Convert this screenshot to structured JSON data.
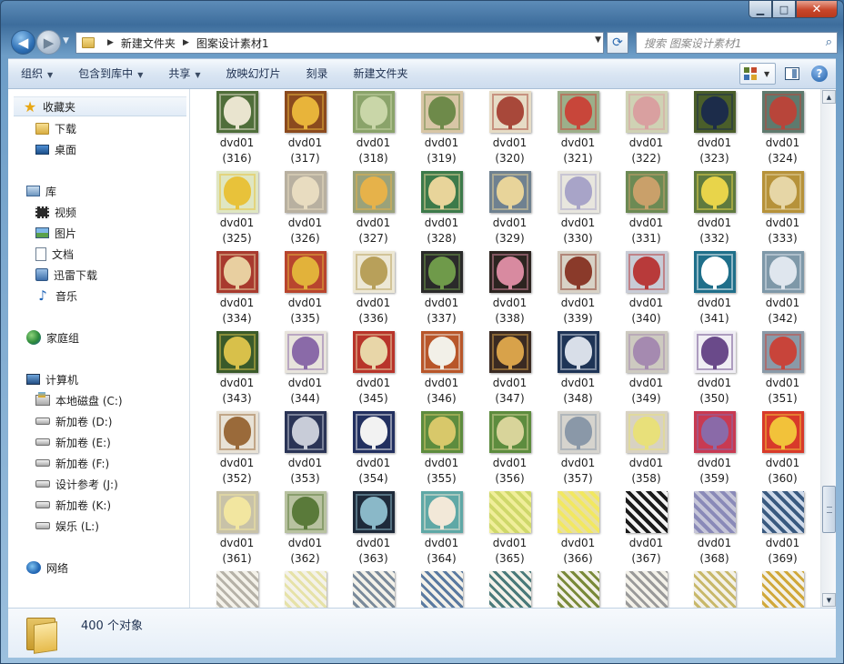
{
  "window": {
    "caption": {
      "minimize": "▁",
      "maximize": "□",
      "close": "✕"
    }
  },
  "address": {
    "crumbs": [
      "新建文件夹",
      "图案设计素材1"
    ],
    "search_placeholder": "搜索 图案设计素材1"
  },
  "toolbar": {
    "items": [
      {
        "label": "组织",
        "dropdown": true
      },
      {
        "label": "包含到库中",
        "dropdown": true
      },
      {
        "label": "共享",
        "dropdown": true
      },
      {
        "label": "放映幻灯片",
        "dropdown": false
      },
      {
        "label": "刻录",
        "dropdown": false
      },
      {
        "label": "新建文件夹",
        "dropdown": false
      }
    ],
    "help_label": "?"
  },
  "sidebar": {
    "favorites": {
      "label": "收藏夹",
      "items": [
        "下载",
        "桌面"
      ]
    },
    "libraries": {
      "label": "库",
      "items": [
        "视频",
        "图片",
        "文档",
        "迅雷下载",
        "音乐"
      ]
    },
    "homegroup": {
      "label": "家庭组"
    },
    "computer": {
      "label": "计算机",
      "items": [
        "本地磁盘 (C:)",
        "新加卷 (D:)",
        "新加卷 (E:)",
        "新加卷 (F:)",
        "设计参考 (J:)",
        "新加卷 (K:)",
        "娱乐 (L:)"
      ]
    },
    "network": {
      "label": "网络"
    }
  },
  "files": {
    "name_prefix": "dvd01",
    "items": [
      "(316)",
      "(317)",
      "(318)",
      "(319)",
      "(320)",
      "(321)",
      "(322)",
      "(323)",
      "(324)",
      "(325)",
      "(326)",
      "(327)",
      "(328)",
      "(329)",
      "(330)",
      "(331)",
      "(332)",
      "(333)",
      "(334)",
      "(335)",
      "(336)",
      "(337)",
      "(338)",
      "(339)",
      "(340)",
      "(341)",
      "(342)",
      "(343)",
      "(344)",
      "(345)",
      "(346)",
      "(347)",
      "(348)",
      "(349)",
      "(350)",
      "(351)",
      "(352)",
      "(353)",
      "(354)",
      "(355)",
      "(356)",
      "(357)",
      "(358)",
      "(359)",
      "(360)",
      "(361)",
      "(362)",
      "(363)",
      "(364)",
      "(365)",
      "(366)",
      "(367)",
      "(368)",
      "(369)"
    ],
    "partial_row_count": 9
  },
  "details": {
    "count_text": "400 个对象"
  },
  "theme": {
    "tile_colors": [
      [
        "#4f6e3a",
        "#e9e4cf"
      ],
      [
        "#8b4a1e",
        "#e8b43a"
      ],
      [
        "#8aa36a",
        "#c9d6a8"
      ],
      [
        "#d8c6a6",
        "#6e8a4a"
      ],
      [
        "#e6dcc6",
        "#a8483a"
      ],
      [
        "#9caf8a",
        "#c8463a"
      ],
      [
        "#cfd2b4",
        "#d9a0a0"
      ],
      [
        "#4a5e2a",
        "#1c2c4a"
      ],
      [
        "#5e7a6e",
        "#b8453a"
      ],
      [
        "#dfe6c2",
        "#e8c23a"
      ],
      [
        "#b8b0a0",
        "#e8dcc0"
      ],
      [
        "#9aa27a",
        "#e6b24a"
      ],
      [
        "#3c7a4a",
        "#e8d49a"
      ],
      [
        "#6f8190",
        "#e8d49a"
      ],
      [
        "#e8e6de",
        "#a8a4c8"
      ],
      [
        "#6c8a54",
        "#c9a06a"
      ],
      [
        "#5f7a3e",
        "#e8d44a"
      ],
      [
        "#b6923a",
        "#e6d6a6"
      ],
      [
        "#a83a2e",
        "#e8cfa0"
      ],
      [
        "#b8452e",
        "#e2b23a"
      ],
      [
        "#ede8d6",
        "#b8a05a"
      ],
      [
        "#2a2a2a",
        "#6f9a4a"
      ],
      [
        "#2c2420",
        "#d88aa0"
      ],
      [
        "#d8d2c6",
        "#8a3a2a"
      ],
      [
        "#c8ccd6",
        "#b83a3a"
      ],
      [
        "#1f6f8a",
        "#ffffff"
      ],
      [
        "#7e98a8",
        "#dfe6ee"
      ],
      [
        "#3a5a2a",
        "#d8c04a"
      ],
      [
        "#e8e4dc",
        "#8a6aa8"
      ],
      [
        "#b8342a",
        "#e8d6a8"
      ],
      [
        "#b8562a",
        "#f2f0e8"
      ],
      [
        "#3a2a22",
        "#d8a24a"
      ],
      [
        "#1e3456",
        "#d8dee8"
      ],
      [
        "#cdcac0",
        "#a58ab0"
      ],
      [
        "#f0eef4",
        "#6a4a8a"
      ],
      [
        "#8a9aa8",
        "#c8443a"
      ],
      [
        "#e8e2d6",
        "#9a6a3a"
      ],
      [
        "#2a3456",
        "#c8ccd8"
      ],
      [
        "#223060",
        "#f2f2f2"
      ],
      [
        "#5d8c3e",
        "#d8c86a"
      ],
      [
        "#5d8c3e",
        "#d8d49a"
      ],
      [
        "#d6d4ce",
        "#8a98a8"
      ],
      [
        "#d8d2c2",
        "#e8e07a"
      ],
      [
        "#c83a52",
        "#8a6aa8"
      ],
      [
        "#d83a2a",
        "#f2c23a"
      ],
      [
        "#c8c2a8",
        "#f2e6a0"
      ],
      [
        "#b8c2a0",
        "#5a7a3a"
      ],
      [
        "#1e2a3a",
        "#8ab8c8"
      ],
      [
        "#5fa8a6",
        "#f2e8d8"
      ],
      [
        "#f0ee9a",
        "#cfd86a"
      ],
      [
        "#f2e860",
        "#e8e0a0"
      ],
      [
        "#1a1a1a",
        "#f2f2f2"
      ],
      [
        "#c6c6d8",
        "#8a8ab8"
      ],
      [
        "#3a5a80",
        "#cfdaea"
      ]
    ],
    "partial_colors": [
      "#b6b2a8",
      "#e6e2a8",
      "#7a8a9a",
      "#5a7aa0",
      "#4a7a7a",
      "#7a8a3a",
      "#9a9a9a",
      "#c8b86a",
      "#d0a83a"
    ]
  }
}
